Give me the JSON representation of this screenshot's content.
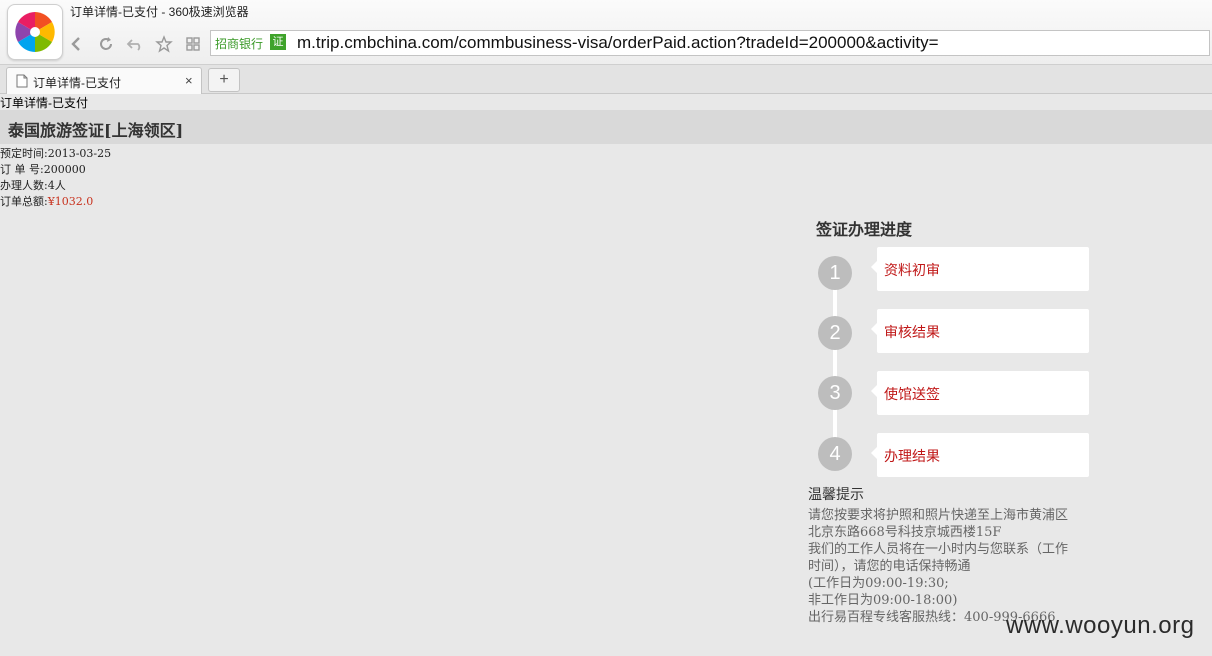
{
  "browser": {
    "window_title": "订单详情-已支付 - 360极速浏览器",
    "bank_label": "招商银行",
    "cert_label": "证",
    "url": "m.trip.cmbchina.com/commbusiness-visa/orderPaid.action?tradeId=200000&activity=",
    "tab_title": "订单详情-已支付",
    "tab_close": "×",
    "new_tab": "+",
    "icons": [
      "back-icon",
      "refresh-icon",
      "undo-icon",
      "star-icon",
      "grid-icon",
      "document-icon"
    ]
  },
  "page": {
    "doc_title": "订单详情-已支付",
    "product_title": "泰国旅游签证[上海领区]",
    "order": {
      "date_label": "预定时间:",
      "date_value": "2013-03-25",
      "number_label": "订 单 号:",
      "number_value": "200000",
      "people_label": "办理人数:",
      "people_value": "4人",
      "amount_label": "订单总额:",
      "amount_value": "¥1032.0"
    },
    "progress": {
      "title": "签证办理进度",
      "steps": [
        {
          "num": "1",
          "label": "资料初审"
        },
        {
          "num": "2",
          "label": "审核结果"
        },
        {
          "num": "3",
          "label": "使馆送签"
        },
        {
          "num": "4",
          "label": "办理结果"
        }
      ]
    },
    "tips": {
      "title": "温馨提示",
      "lines": [
        "请您按要求将护照和照片快递至上海市黄浦区",
        "北京东路668号科技京城西楼15F",
        "我们的工作人员将在一小时内与您联系（工作",
        "时间），请您的电话保持畅通",
        "(工作日为09:00-19:30;",
        "非工作日为09:00-18:00)",
        "出行易百程专线客服热线：400-999-6666"
      ]
    },
    "watermark": "www.wooyun.org",
    "accent_color": "#c01818"
  }
}
